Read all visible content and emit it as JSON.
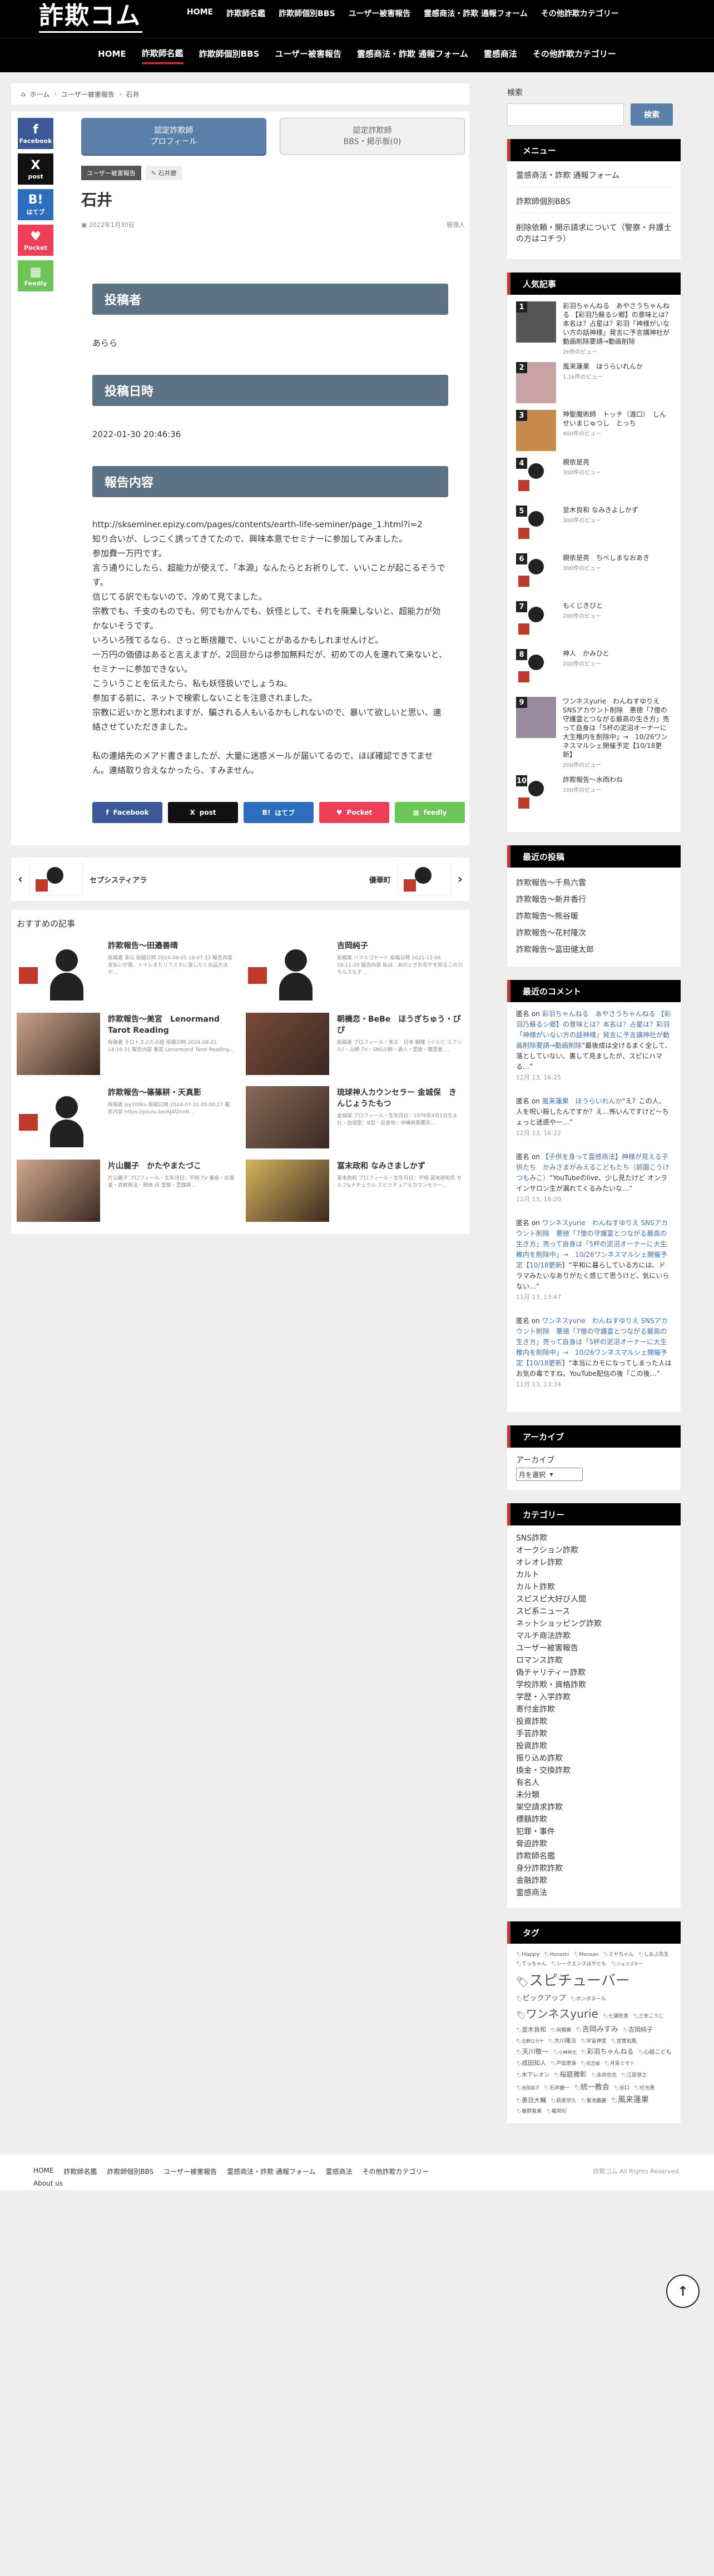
{
  "header": {
    "logo": "詐欺コム",
    "top_nav": [
      "HOME",
      "詐欺師名鑑",
      "詐欺師個別BBS",
      "ユーザー被害報告",
      "霊感商法・詐欺 通報フォーム",
      "その他詐欺カテゴリー"
    ],
    "main_nav": [
      "HOME",
      "詐欺師名鑑",
      "詐欺師個別BBS",
      "ユーザー被害報告",
      "霊感商法・詐欺 通報フォーム",
      "霊感商法",
      "その他詐欺カテゴリー"
    ]
  },
  "breadcrumb": {
    "home": "ホーム",
    "parent": "ユーザー被害報告",
    "current": "石井"
  },
  "share_side": [
    {
      "label": "Facebook",
      "icon": "f",
      "color": "#3b5998"
    },
    {
      "label": "post",
      "icon": "X",
      "color": "#111111"
    },
    {
      "label": "はてブ",
      "icon": "B!",
      "color": "#2c6ebd"
    },
    {
      "label": "Pocket",
      "icon": "♥",
      "color": "#ef3f56"
    },
    {
      "label": "Feedly",
      "icon": "▦",
      "color": "#6cc655"
    }
  ],
  "article": {
    "tab_active_line1": "認定詐欺師",
    "tab_active_line2": "プロフィール",
    "tab_inactive_line1": "認定詐欺師",
    "tab_inactive_line2": "BBS・掲示板(0)",
    "category": "ユーザー被害報告",
    "tag": "石井慶",
    "title": "石井",
    "date": "2022年1月30日",
    "author": "管理人",
    "h_poster": "投稿者",
    "poster": "あらら",
    "h_date": "投稿日時",
    "posted_at": "2022-01-30 20:46:36",
    "h_content": "報告内容",
    "content": [
      "http://skseminer.epizy.com/pages/contents/earth-life-seminer/page_1.html?i=2",
      "知り合いが、しつこく誘ってきてたので、興味本意でセミナーに参加してみました。",
      "参加費一万円です。",
      "言う通りにしたら、超能力が使えて、「本源」なんたらとお祈りして、いいことが起こるそうです。",
      "信じてる訳でもないので、冷めて見てました。",
      "宗教でも、千支のものでも、何でもかんでも、妖怪として、それを廃棄しないと、超能力が効かないそうです。",
      "いろいろ残てるなら、さっと断捨離で、いいことがあるかもしれませんけど。",
      "一万円の価値はあると言えますが、2回目からは参加無料だが、初めての人を連れて来ないと、セミナーに参加できない。",
      "こういうことを伝えたら、私も妖怪扱いでしょうね。",
      "参加する前に、ネットで検索しないことを注意されました。",
      "宗教に近いかと思われますが、騙される人もいるかもしれないので、暴いて欲しいと思い、連絡させていただきました。"
    ],
    "content_last": "私の連絡先のメアド書きましたが、大量に迷惑メールが届いてるので、ほぼ確認できてません。連絡取り合えなかったら、すみません。"
  },
  "share_bottom": [
    {
      "label": "Facebook",
      "icon": "f",
      "color": "#3b5998"
    },
    {
      "label": "post",
      "icon": "X",
      "color": "#111111"
    },
    {
      "label": "はてブ",
      "icon": "B!",
      "color": "#2c6ebd"
    },
    {
      "label": "Pocket",
      "icon": "♥",
      "color": "#ef3f56"
    },
    {
      "label": "feedly",
      "icon": "▦",
      "color": "#6cc655"
    }
  ],
  "post_nav": {
    "prev": "セプシスティアラ",
    "next": "優華町"
  },
  "recommend": {
    "heading": "おすすめの記事",
    "items": [
      {
        "title": "詐欺報告〜田邉善晴",
        "excerpt": "投稿者 非公 投稿日時 2024-08-05 19:07:33 報告内容 支払いが度、トイレまたリラスタに渡したく出品方法が…"
      },
      {
        "title": "吉岡純子",
        "excerpt": "投稿者 ハマルコヤード 投稿日時 2021-12-06 18:11:20 報告内容 私は、あのときお花やを知るこの力ちらスな子…"
      },
      {
        "title": "詐欺報告〜美宮　Lenormand Tarot Reading",
        "excerpt": "投稿者 子ロトスぶたの姫 投稿日時 2024-08-21 14:16:31 報告内容 美宮 Lenormand Tarot Reading…"
      },
      {
        "title": "朝機恋・BeBe　ほうぎちゅう・ぴぴ",
        "excerpt": "投稿者 プロフィール・来る　日本 朝様（イルミ スフリル）・占師 TV・SNS占師・通人・霊能・鑑霊者 …"
      },
      {
        "title": "詐欺報告〜篠篠耕・天真影",
        "excerpt": "投稿者 jsy100ku 投稿日時 2024-07-31 05:00:17 報告内容 https://youtu.be/AJ4f2nn9…"
      },
      {
        "title": "琉球神人カウンセラー 金城保　きんじょうたもつ",
        "excerpt": "金城保 プロフィール・生年月日：1976年4月1日生まれ・血液型：B型・出身地：沖縄県那覇市…"
      },
      {
        "title": "片山麗子　かたやまたづこ",
        "excerpt": "片山麗子 プロフィール・生年月日：不明 TV 番組・出演者・詐欺商法・関西 月 霊感・霊媒師…"
      },
      {
        "title": "冨末政和 なみさましかず",
        "excerpt": "冨末政和 プロフィール・生年月日：不明 冨末政和氏 セルフ&ナチュラル スピリチュアルカウンセラー…"
      }
    ]
  },
  "sidebar": {
    "search_label": "検索",
    "search_button": "検索",
    "menu_head": "メニュー",
    "menu_items": [
      "霊感商法・詐欺 通報フォーム",
      "詐欺師個別BBS",
      "削除依頼・開示請求について（警察・弁護士の方はコチラ）"
    ],
    "popular_head": "人気記事",
    "popular": [
      {
        "rank": "1",
        "title": "彩羽ちゃんねる　あやさうちゃんねる 【彩羽乃蘇るシ郷】の意味とは？本名は？占星は？彩羽「神様がいない方の話神様」発言に予言講神社が動画削除要請→動画削除",
        "views": "2k件のビュー"
      },
      {
        "rank": "2",
        "title": "風来蓮果　ほうらいれんか",
        "views": "1.1k件のビュー"
      },
      {
        "rank": "3",
        "title": "神聖魔術師　トッチ（渡口）　しんせいまじゅつし　とっち",
        "views": "400件のビュー"
      },
      {
        "rank": "4",
        "title": "親依是亮",
        "views": "300件のビュー"
      },
      {
        "rank": "5",
        "title": "並木良和 なみきよしかず",
        "views": "300件のビュー"
      },
      {
        "rank": "6",
        "title": "親依是亮　ちべしまなおあき",
        "views": "300件のビュー"
      },
      {
        "rank": "7",
        "title": "もくじきびと",
        "views": "200件のビュー"
      },
      {
        "rank": "8",
        "title": "神人　かみひと",
        "views": "200件のビュー"
      },
      {
        "rank": "9",
        "title": "ワンネスyurie　わんねすゆりえ SNSアカウント削除　悪徳「7億の守護霊とつながる最高の生き方」売って自身は「5杯の泥沼オーナーに大生稚内を削除中」→　10/26ワンネスマルシェ開催予定【10/18更新】",
        "views": "200件のビュー"
      },
      {
        "rank": "10",
        "title": "詐欺報告〜水雨わね",
        "views": "100件のビュー"
      }
    ],
    "recent_head": "最近の投稿",
    "recent": [
      "詐欺報告〜千鳥六雲",
      "詐欺報告〜新井香行",
      "詐欺報告〜熊谷暖",
      "詐欺報告〜花村隆次",
      "詐欺報告〜冨田健太郎"
    ],
    "comments_head": "最近のコメント",
    "comments": [
      {
        "who": "匿名 on ",
        "link": "彩羽ちゃんねる　あやさうちゃんねる 【彩羽乃蘇るシ郷】の意味とは？本名は？占星は？彩羽「神様がいない方の話神様」発言に予言講神社が動画削除要請→動画削除",
        "text": "“最後成は全けるまく全して、落としていない。裏して見ましたが、スピにハマる…”",
        "date": "12月 13, 16:25"
      },
      {
        "who": "匿名 on ",
        "link": "風来蓮果　ほうらいれんか",
        "text": "“え？この人、人を呪い殺したんですか？え…怖いんですけど～ちょっと迷惑やー…”",
        "date": "12月 13, 16:22"
      },
      {
        "who": "匿名 on ",
        "link": "【子供を身って霊感商法】神様が見える子供たち　かみさまがみえるこどもたち（前園こうけつもみこ）",
        "text": "“YouTubeのlive、少し見たけど オンラインサロン生が漏れてくるみたいな…”",
        "date": "12月 13, 16:20"
      },
      {
        "who": "匿名 on ",
        "link": "ワンネスyurie　わんねすゆりえ SNSアカウント削除　悪徳「7億の守護霊とつながる最高の生き方」売って自身は「5杯の泥沼オーナーに大生稚内を削除中」→　10/26ワンネスマルシェ開催予定【10/18更新】",
        "text": "“平和に暮らしている方には、ドラマみたいなありがたく感じて思うけど、気にいらない…”",
        "date": "11月 13, 13:47"
      },
      {
        "who": "匿名 on ",
        "link": "ワンネスyurie　わんねすゆりえ SNSアカウント削除　悪徳「7億の守護霊とつながる最高の生き方」売って自身は「5杯の泥沼オーナーに大生稚内を削除中」→　10/26ワンネスマルシェ開催予定【10/18更新】",
        "text": "“本当にカモになってしまった人はお気の毒ですね。YouTube配信の後「この後…”",
        "date": "11月 13, 13:34"
      }
    ],
    "archive_head": "アーカイブ",
    "archive_label": "アーカイブ",
    "archive_select": "月を選択",
    "category_head": "カテゴリー",
    "categories": [
      "SNS詐欺",
      "オークション詐欺",
      "オレオレ詐欺",
      "カルト",
      "カルト詐欺",
      "スピスピ大好び人間",
      "スピ系ニュース",
      "ネットショッピング詐欺",
      "マルチ商法詐欺",
      "ユーザー被害報告",
      "ロマンス詐欺",
      "偽チャリティー詐欺",
      "学校詐欺・資格詐欺",
      "学歴・入学詐欺",
      "寄付金詐欺",
      "投資詐欺",
      "手芸詐欺",
      "投資詐欺",
      "振り込め詐欺",
      "換金・交換詐欺",
      "有名人",
      "未分類",
      "架空請求詐欺",
      "標額詐欺",
      "犯罪・事件",
      "脅迫詐欺",
      "詐欺師名鑑",
      "身分詐欺詐欺",
      "金融詐欺",
      "霊感商法"
    ],
    "tag_head": "タグ",
    "tags": [
      {
        "t": "Happy",
        "s": 10
      },
      {
        "t": "Honami",
        "s": 9
      },
      {
        "t": "Monsan",
        "s": 9
      },
      {
        "t": "ミヤちゃん",
        "s": 9
      },
      {
        "t": "しおぶ先生",
        "s": 9
      },
      {
        "t": "てっちゃん",
        "s": 9
      },
      {
        "t": "シークエンスはやとも",
        "s": 9
      },
      {
        "t": "ジュリズキー",
        "s": 8
      },
      {
        "t": "スピチューバー",
        "s": 26
      },
      {
        "t": "ピックアップ",
        "s": 13
      },
      {
        "t": "ボンボヌール",
        "s": 9
      },
      {
        "t": "ワンネスyurie",
        "s": 20
      },
      {
        "t": "七瀬哲恵",
        "s": 9
      },
      {
        "t": "三冬こうじ",
        "s": 9
      },
      {
        "t": "並木良和",
        "s": 11
      },
      {
        "t": "両親寡",
        "s": 9
      },
      {
        "t": "吉岡みすみ",
        "s": 13
      },
      {
        "t": "吉岡純子",
        "s": 11
      },
      {
        "t": "吉野ロカヤ",
        "s": 8
      },
      {
        "t": "大川隆法",
        "s": 10
      },
      {
        "t": "宇宙神霊",
        "s": 9
      },
      {
        "t": "宮寶知鳳",
        "s": 9
      },
      {
        "t": "天川敬一",
        "s": 12
      },
      {
        "t": "小林神光",
        "s": 8
      },
      {
        "t": "彩羽ちゃんねる",
        "s": 12
      },
      {
        "t": "心結こども",
        "s": 10
      },
      {
        "t": "成田知人",
        "s": 11
      },
      {
        "t": "戸田恵保",
        "s": 9
      },
      {
        "t": "旺志緑",
        "s": 8
      },
      {
        "t": "月兎ミサト",
        "s": 9
      },
      {
        "t": "木下レオン",
        "s": 10
      },
      {
        "t": "桜庭雅彰",
        "s": 12
      },
      {
        "t": "永井信也",
        "s": 9
      },
      {
        "t": "江原啓之",
        "s": 9
      },
      {
        "t": "池田昌子",
        "s": 8
      },
      {
        "t": "石井慶一",
        "s": 9
      },
      {
        "t": "統一教会",
        "s": 13
      },
      {
        "t": "谷口",
        "s": 9
      },
      {
        "t": "社光悪",
        "s": 9
      },
      {
        "t": "美日大輔",
        "s": 11
      },
      {
        "t": "萩原宗久",
        "s": 9
      },
      {
        "t": "菊池義慶",
        "s": 9
      },
      {
        "t": "風来蓮果",
        "s": 14
      },
      {
        "t": "養野直美",
        "s": 9
      },
      {
        "t": "龍邦杉",
        "s": 9
      }
    ]
  },
  "footer": {
    "nav": [
      "HOME",
      "詐欺師名鑑",
      "詐欺師個別BBS",
      "ユーザー被害報告",
      "霊感商法・詐欺 通報フォーム",
      "霊感商法",
      "その他詐欺カテゴリー"
    ],
    "about": "About us",
    "copyright": "詐欺コム All Rights Reserved."
  }
}
